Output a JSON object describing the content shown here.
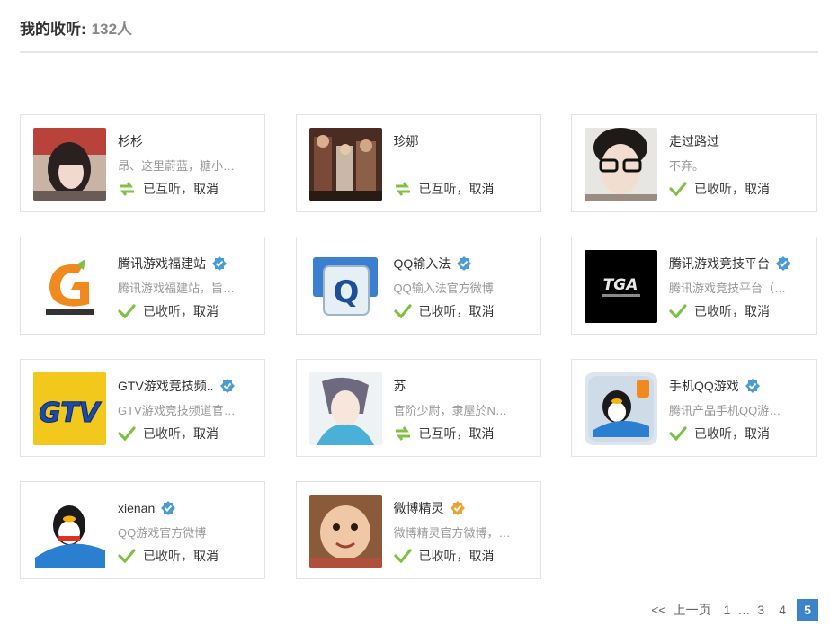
{
  "header": {
    "title": "我的收听:",
    "count": "132人"
  },
  "cards": [
    {
      "name": "杉杉",
      "verified": "",
      "desc": "昂、这里蔚蓝，糖小…",
      "status": "已互听，",
      "status_icon": "mutual-arrows-icon",
      "cancel": "取消",
      "avatar": "girl-photo"
    },
    {
      "name": "珍娜",
      "verified": "",
      "desc": "",
      "status": "已互听，",
      "status_icon": "mutual-arrows-icon",
      "cancel": "取消",
      "avatar": "crowd-photo"
    },
    {
      "name": "走过路过",
      "verified": "",
      "desc": "不弃。",
      "status": "已收听，",
      "status_icon": "check-icon",
      "cancel": "取消",
      "avatar": "glasses-photo"
    },
    {
      "name": "腾讯游戏福建站",
      "verified": "blue",
      "desc": "腾讯游戏福建站，旨…",
      "status": "已收听，",
      "status_icon": "check-icon",
      "cancel": "取消",
      "avatar": "tencent-games-logo"
    },
    {
      "name": "QQ输入法",
      "verified": "blue",
      "desc": "QQ输入法官方微博",
      "status": "已收听，",
      "status_icon": "check-icon",
      "cancel": "取消",
      "avatar": "qq-input-logo"
    },
    {
      "name": "腾讯游戏竞技平台",
      "verified": "blue",
      "desc": "腾讯游戏竞技平台（…",
      "status": "已收听，",
      "status_icon": "check-icon",
      "cancel": "取消",
      "avatar": "tga-logo"
    },
    {
      "name": "GTV游戏竞技频..",
      "verified": "blue",
      "desc": "GTV游戏竞技频道官…",
      "status": "已收听，",
      "status_icon": "check-icon",
      "cancel": "取消",
      "avatar": "gtv-logo"
    },
    {
      "name": "苏",
      "verified": "",
      "desc": "官阶少尉，隶屋於N…",
      "status": "已互听，",
      "status_icon": "mutual-arrows-icon",
      "cancel": "取消",
      "avatar": "anime-photo"
    },
    {
      "name": "手机QQ游戏",
      "verified": "blue",
      "desc": "腾讯产品手机QQ游…",
      "status": "已收听，",
      "status_icon": "check-icon",
      "cancel": "取消",
      "avatar": "qq-game-logo"
    },
    {
      "name": "xienan",
      "verified": "blue",
      "desc": "QQ游戏官方微博",
      "status": "已收听，",
      "status_icon": "check-icon",
      "cancel": "取消",
      "avatar": "qq-penguin-logo"
    },
    {
      "name": "微博精灵",
      "verified": "orange",
      "desc": "微博精灵官方微博，…",
      "status": "已收听，",
      "status_icon": "check-icon",
      "cancel": "取消",
      "avatar": "baby-photo"
    }
  ],
  "pager": {
    "prev_arrow": "<<",
    "prev": "上一页",
    "p1": "1",
    "ellipsis": "…",
    "p3": "3",
    "p4": "4",
    "current": "5"
  },
  "colors": {
    "accent": "#3b84c9",
    "verified_blue": "#4a9cd6",
    "verified_orange": "#f0a030",
    "check": "#7cc243"
  }
}
